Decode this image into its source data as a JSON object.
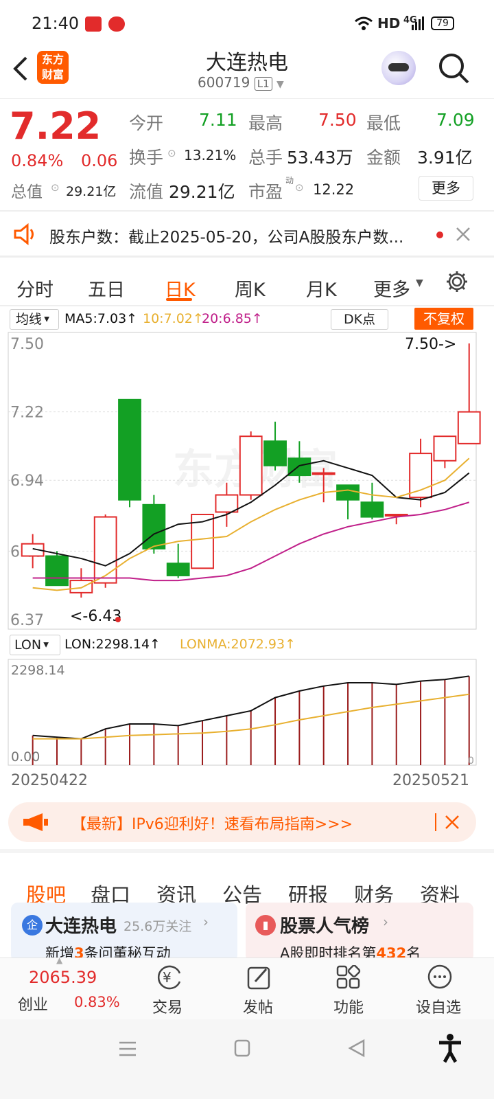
{
  "status": {
    "time": "21:40",
    "network": "HD",
    "signal": "4G",
    "battery": "79"
  },
  "header": {
    "title": "大连热电",
    "code": "600719",
    "level": "L1",
    "logo_line1": "东方",
    "logo_line2": "财富"
  },
  "quote": {
    "price": "7.22",
    "change_pct": "0.84%",
    "change": "0.06",
    "open_label": "今开",
    "open": "7.11",
    "high_label": "最高",
    "high": "7.50",
    "low_label": "最低",
    "low": "7.09",
    "turnover_label": "换手",
    "turnover": "13.21%",
    "volume_label": "总手",
    "volume": "53.43万",
    "amount_label": "金额",
    "amount": "3.91亿",
    "mktcap_label": "总值",
    "mktcap": "29.21亿",
    "float_label": "流值",
    "float": "29.21亿",
    "pe_label": "市盈",
    "pe_sup": "动",
    "pe": "12.22",
    "more": "更多"
  },
  "notice": {
    "text": "股东户数：截止2025-05-20，公司A股股东户数..."
  },
  "tabs": [
    "分时",
    "五日",
    "日K",
    "周K",
    "月K",
    "更多"
  ],
  "active_tab": "日K",
  "ma_bar": {
    "selector": "均线",
    "ma5": "MA5:7.03↑",
    "ma10": "10:7.02↑",
    "ma20": "20:6.85↑",
    "dk": "DK点",
    "fq": "不复权"
  },
  "kline": {
    "y_labels": [
      "7.50",
      "7.22",
      "6.94",
      "6.65",
      "6.37"
    ],
    "max_label": "7.50->",
    "min_label": "<-6.43"
  },
  "lon_bar": {
    "selector": "LON",
    "lon": "LON:2298.14↑",
    "lonma": "LONMA:2072.93↑"
  },
  "lon_chart": {
    "top_label": "2298.14",
    "bottom_label": "0.00",
    "right_label": "0",
    "date_start": "20250422",
    "date_end": "20250521"
  },
  "banner": {
    "text": "【最新】IPv6迎利好！速看布局指南>>>"
  },
  "subtabs": [
    "股吧",
    "盘口",
    "资讯",
    "公告",
    "研报",
    "财务",
    "资料"
  ],
  "active_subtab": "股吧",
  "cards": {
    "left": {
      "badge": "企",
      "title": "大连热电",
      "follow": "25.6万关注",
      "sub_pre": "新增",
      "sub_num": "3",
      "sub_post": "条问董秘互动"
    },
    "right": {
      "title": "股票人气榜",
      "sub_pre": "A股即时排名第",
      "sub_num": "432",
      "sub_post": "名"
    }
  },
  "bottom": {
    "index_value": "2065.39",
    "index_name": "创业",
    "index_pct": "0.83%",
    "trade": "交易",
    "post": "发帖",
    "func": "功能",
    "watch": "设自选"
  },
  "watermark": "东方财富",
  "colors": {
    "up": "#e22b2b",
    "down": "#13a024",
    "accent": "#ff5a00",
    "ma10": "#e8b030",
    "ma20": "#c0208a"
  },
  "chart_data": {
    "type": "candlestick",
    "dates_range": [
      "20250422",
      "20250521"
    ],
    "ohlc": [
      [
        6.63,
        6.68,
        6.58,
        6.72
      ],
      [
        6.63,
        6.51,
        6.51,
        6.65
      ],
      [
        6.48,
        6.53,
        6.46,
        6.58
      ],
      [
        6.52,
        6.79,
        6.5,
        6.8
      ],
      [
        7.27,
        6.86,
        6.83,
        7.27
      ],
      [
        6.84,
        6.66,
        6.64,
        6.88
      ],
      [
        6.6,
        6.55,
        6.54,
        6.68
      ],
      [
        6.58,
        6.8,
        6.58,
        6.8
      ],
      [
        6.81,
        6.88,
        6.75,
        6.93
      ],
      [
        6.88,
        7.12,
        6.86,
        7.14
      ],
      [
        7.1,
        7.0,
        6.98,
        7.18
      ],
      [
        7.03,
        6.96,
        6.93,
        7.1
      ],
      [
        6.97,
        6.97,
        6.85,
        6.99
      ],
      [
        6.92,
        6.86,
        6.78,
        6.92
      ],
      [
        6.85,
        6.79,
        6.78,
        6.93
      ],
      [
        6.8,
        6.8,
        6.76,
        6.8
      ],
      [
        6.87,
        7.05,
        6.83,
        7.11
      ],
      [
        7.02,
        7.12,
        6.99,
        7.12
      ],
      [
        7.09,
        7.22,
        7.09,
        7.5
      ]
    ],
    "ma5": [
      6.66,
      6.64,
      6.62,
      6.59,
      6.64,
      6.72,
      6.76,
      6.77,
      6.8,
      6.85,
      6.92,
      7.0,
      7.02,
      6.99,
      6.96,
      6.87,
      6.86,
      6.89,
      6.97
    ],
    "ma10": [
      6.5,
      6.49,
      6.5,
      6.55,
      6.62,
      6.67,
      6.69,
      6.7,
      6.71,
      6.77,
      6.82,
      6.86,
      6.89,
      6.9,
      6.88,
      6.87,
      6.9,
      6.94,
      7.03
    ],
    "ma20": [
      6.54,
      6.54,
      6.54,
      6.54,
      6.54,
      6.53,
      6.53,
      6.54,
      6.55,
      6.58,
      6.63,
      6.68,
      6.72,
      6.75,
      6.77,
      6.79,
      6.8,
      6.82,
      6.85
    ],
    "lon": [
      180,
      170,
      160,
      220,
      250,
      250,
      240,
      270,
      300,
      330,
      410,
      450,
      480,
      500,
      500,
      490,
      510,
      520,
      540
    ],
    "lonma": [
      160,
      160,
      160,
      170,
      180,
      185,
      190,
      195,
      205,
      220,
      245,
      275,
      300,
      325,
      350,
      370,
      390,
      410,
      430
    ],
    "ylim": [
      6.37,
      7.5
    ]
  }
}
